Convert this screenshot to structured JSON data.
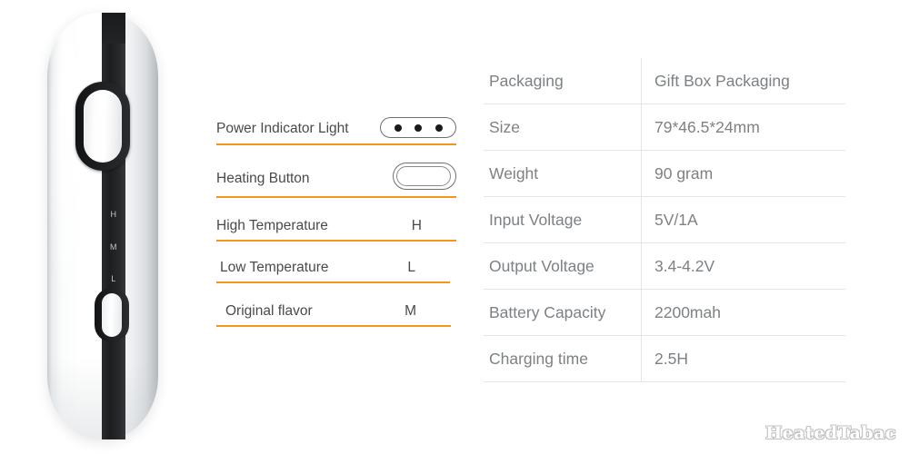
{
  "product_image": {
    "alt": "white heated tobacco device front view",
    "markings": [
      "H",
      "M",
      "L"
    ],
    "parts": {
      "power_button": "large oval power button",
      "mode_button": "small oval mode button",
      "stripe": "black vertical stripe"
    },
    "colors": {
      "body": "#ffffff",
      "stripe": "#1d1e20",
      "marking_text": "#c3c6ca"
    }
  },
  "legend": {
    "accent_color": "#f2951e",
    "text_color": "#4a4a4a",
    "rows": [
      {
        "label": "Power Indicator Light",
        "value": "",
        "icon": "three-dot-pill-icon",
        "dots": 3
      },
      {
        "label": "Heating Button",
        "value": "",
        "icon": "stadium-button-icon"
      },
      {
        "label": "High Temperature",
        "value": "H",
        "icon": ""
      },
      {
        "label": "Low  Temperature",
        "value": "L",
        "icon": ""
      },
      {
        "label": "Original flavor",
        "value": "M",
        "icon": ""
      }
    ]
  },
  "spec_table": {
    "line_color": "#e3e5e6",
    "text_color": "#7d8184",
    "rows": [
      {
        "key": "Packaging",
        "value": "Gift Box Packaging"
      },
      {
        "key": "Size",
        "value": "79*46.5*24mm"
      },
      {
        "key": "Weight",
        "value": "90 gram"
      },
      {
        "key": "Input Voltage",
        "value": "5V/1A"
      },
      {
        "key": "Output Voltage",
        "value": "3.4-4.2V"
      },
      {
        "key": "Battery Capacity",
        "value": "2200mah"
      },
      {
        "key": "Charging time",
        "value": "2.5H"
      }
    ]
  },
  "watermark": {
    "text": "HeatedTabac"
  }
}
